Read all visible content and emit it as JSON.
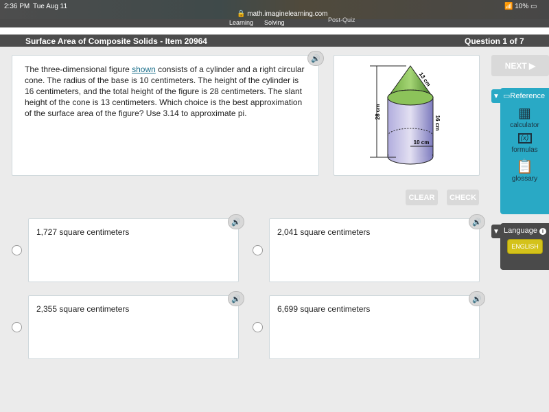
{
  "status_bar": {
    "time": "2:36 PM",
    "date": "Tue Aug 11",
    "url": "math.imaginelearning.com",
    "battery": "10%"
  },
  "nav": {
    "items": [
      "Learning",
      "Solving",
      "Post-Quiz"
    ]
  },
  "header": {
    "title": "Surface Area of Composite Solids - Item 20964",
    "progress": "Question 1 of 7"
  },
  "question": {
    "text_before": "The three-dimensional figure ",
    "link": "shown",
    "text_after": " consists of a cylinder and a right circular cone. The radius of the base is 10 centimeters. The height of the cylinder is 16 centimeters, and the total height of the figure is 28 centimeters. The slant height of the cone is 13 centimeters. Which choice is the best approximation of the surface area of the figure? Use 3.14 to approximate pi."
  },
  "figure": {
    "labels": {
      "total_height": "28 cm",
      "slant": "13 cm",
      "cyl_height": "16 cm",
      "radius": "10 cm"
    },
    "colors": {
      "cone": "#8cc35a",
      "cylinder": "#b7b3e0"
    }
  },
  "buttons": {
    "next": "NEXT ▶",
    "clear": "CLEAR",
    "check": "CHECK"
  },
  "reference": {
    "title": "Reference",
    "items": [
      {
        "label": "calculator",
        "icon": "calculator-icon"
      },
      {
        "label": "formulas",
        "icon": "formulas-icon"
      },
      {
        "label": "glossary",
        "icon": "clipboard-icon"
      }
    ]
  },
  "language": {
    "title": "Language",
    "selected": "ENGLISH"
  },
  "answers": [
    {
      "text": "1,727 square centimeters"
    },
    {
      "text": "2,041 square centimeters"
    },
    {
      "text": "2,355 square centimeters"
    },
    {
      "text": "6,699 square centimeters"
    }
  ],
  "colors": {
    "reference": "#29a9c5",
    "language_button": "#d4c21a",
    "title_bar": "#4c4c4c"
  }
}
